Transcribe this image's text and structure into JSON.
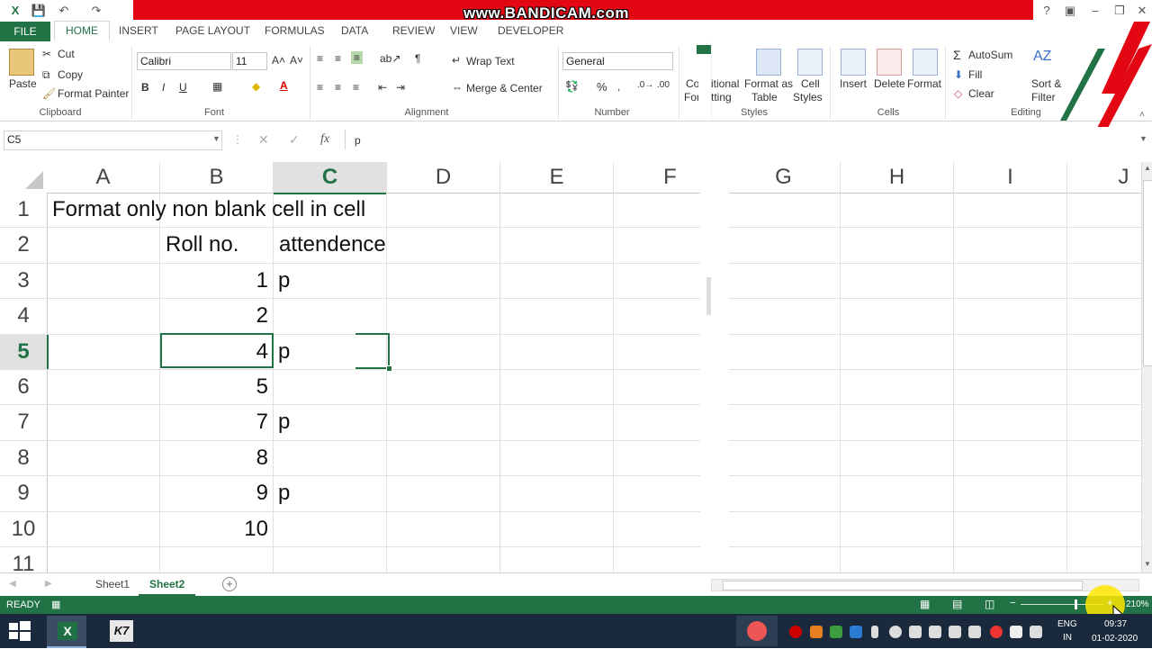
{
  "watermark": "www.BANDICAM.com",
  "tabs": {
    "file": "FILE",
    "home": "HOME",
    "insert": "INSERT",
    "page_layout": "PAGE LAYOUT",
    "formulas": "FORMULAS",
    "data": "DATA",
    "review": "REVIEW",
    "view": "VIEW",
    "developer": "DEVELOPER"
  },
  "clipboard": {
    "paste": "Paste",
    "cut": "Cut",
    "copy": "Copy",
    "format_painter": "Format Painter",
    "group": "Clipboard"
  },
  "font": {
    "name": "Calibri",
    "size": "11",
    "bold": "B",
    "italic": "I",
    "underline": "U",
    "group": "Font"
  },
  "alignment": {
    "wrap_text": "Wrap Text",
    "merge_center": "Merge & Center",
    "group": "Alignment"
  },
  "number": {
    "format": "General",
    "percent": "%",
    "group": "Number"
  },
  "styles": {
    "conditional_line1": "Co",
    "conditional_line2": "For",
    "conditional_frag": "itional",
    "conditional_frag2": "tting",
    "format_as_table_line1": "Format as",
    "format_as_table_line2": "Table",
    "cell_styles_line1": "Cell",
    "cell_styles_line2": "Styles",
    "group": "Styles"
  },
  "cells": {
    "insert": "Insert",
    "delete": "Delete",
    "format": "Format",
    "group": "Cells"
  },
  "editing": {
    "autosum": "AutoSum",
    "fill": "Fill",
    "clear": "Clear",
    "sort_line1": "Sort &",
    "sort_line2": "Filter",
    "group": "Editing"
  },
  "formula_bar": {
    "name_box": "C5",
    "fx": "fx",
    "value": "p"
  },
  "columns": [
    "A",
    "B",
    "C",
    "D",
    "E",
    "F",
    "G",
    "H",
    "I",
    "J"
  ],
  "rows": [
    "1",
    "2",
    "3",
    "4",
    "5",
    "6",
    "7",
    "8",
    "9",
    "10",
    "11"
  ],
  "sheet": {
    "title": "Format only non blank cell in cell",
    "header_b": "Roll no.",
    "header_c": "attendence",
    "roll": [
      "1",
      "2",
      "4",
      "5",
      "7",
      "8",
      "9",
      "10"
    ],
    "attendance": [
      "p",
      "",
      "p",
      "",
      "p",
      "",
      "p",
      ""
    ]
  },
  "sheet_tabs": [
    "Sheet1",
    "Sheet2"
  ],
  "status": {
    "ready": "READY",
    "zoom": "210%"
  },
  "taskbar": {
    "lang1": "ENG",
    "lang2": "IN",
    "time": "09:37",
    "date": "01-02-2020"
  },
  "colors": {
    "excel_green": "#217346",
    "bandicam_red": "#e30613"
  }
}
